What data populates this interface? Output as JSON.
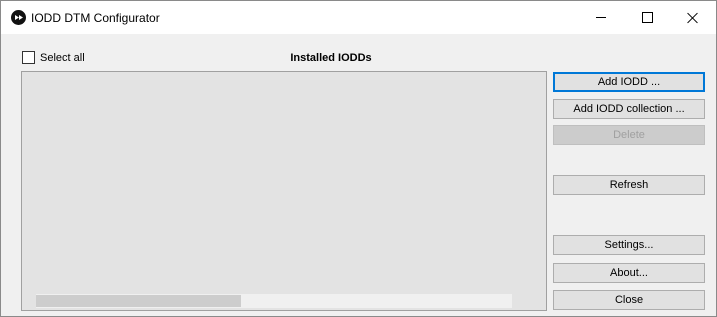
{
  "window": {
    "title": "IODD DTM Configurator"
  },
  "titlebar_icons": {
    "app": "app-logo-icon",
    "minimize": "minimize-icon",
    "maximize": "maximize-icon",
    "close": "close-icon"
  },
  "select_all": {
    "label": "Select all",
    "checked": false
  },
  "list": {
    "title": "Installed IODDs",
    "items": []
  },
  "buttons": {
    "add_iodd": "Add IODD ...",
    "add_iodd_collection": "Add IODD collection ...",
    "delete": "Delete",
    "refresh": "Refresh",
    "settings": "Settings...",
    "about": "About...",
    "close": "Close"
  },
  "colors": {
    "accent": "#0078d7",
    "panel": "#e3e3e3",
    "window": "#f0f0f0",
    "disabled_text": "#a0a0a0"
  }
}
